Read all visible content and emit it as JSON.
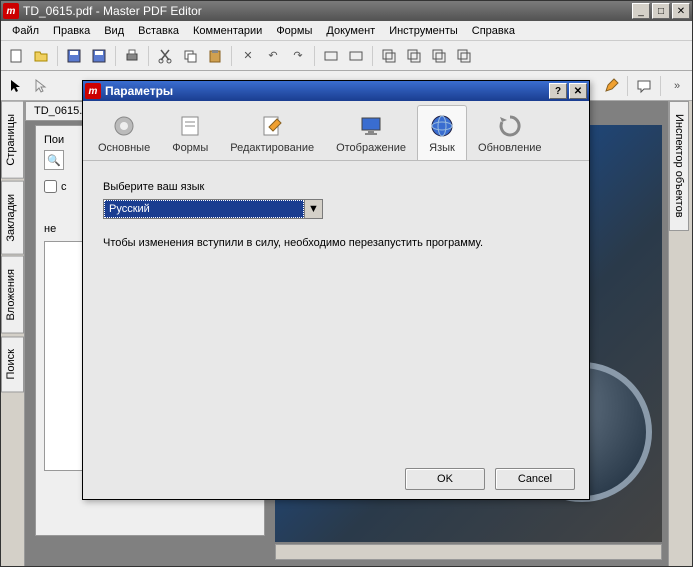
{
  "window": {
    "title": "TD_0615.pdf - Master PDF Editor",
    "app_icon_letter": "m"
  },
  "menu": {
    "items": [
      "Файл",
      "Правка",
      "Вид",
      "Вставка",
      "Комментарии",
      "Формы",
      "Документ",
      "Инструменты",
      "Справка"
    ]
  },
  "doc_tab": {
    "label": "TD_0615.pd..."
  },
  "left_panel": {
    "search_label": "Пои",
    "no_label": "не",
    "tabs": [
      "Страницы",
      "Закладки",
      "Вложения",
      "Поиск"
    ]
  },
  "right_panel": {
    "tab": "Инспектор объектов"
  },
  "dialog": {
    "title": "Параметры",
    "tabs": [
      {
        "id": "general",
        "label": "Основные"
      },
      {
        "id": "forms",
        "label": "Формы"
      },
      {
        "id": "editing",
        "label": "Редактирование"
      },
      {
        "id": "display",
        "label": "Отображение"
      },
      {
        "id": "language",
        "label": "Язык"
      },
      {
        "id": "update",
        "label": "Обновление"
      }
    ],
    "body": {
      "choose_label": "Выберите ваш язык",
      "language_value": "Русский",
      "hint": "Чтобы изменения вступили в силу, необходимо перезапустить программу."
    },
    "buttons": {
      "ok": "OK",
      "cancel": "Cancel"
    }
  }
}
